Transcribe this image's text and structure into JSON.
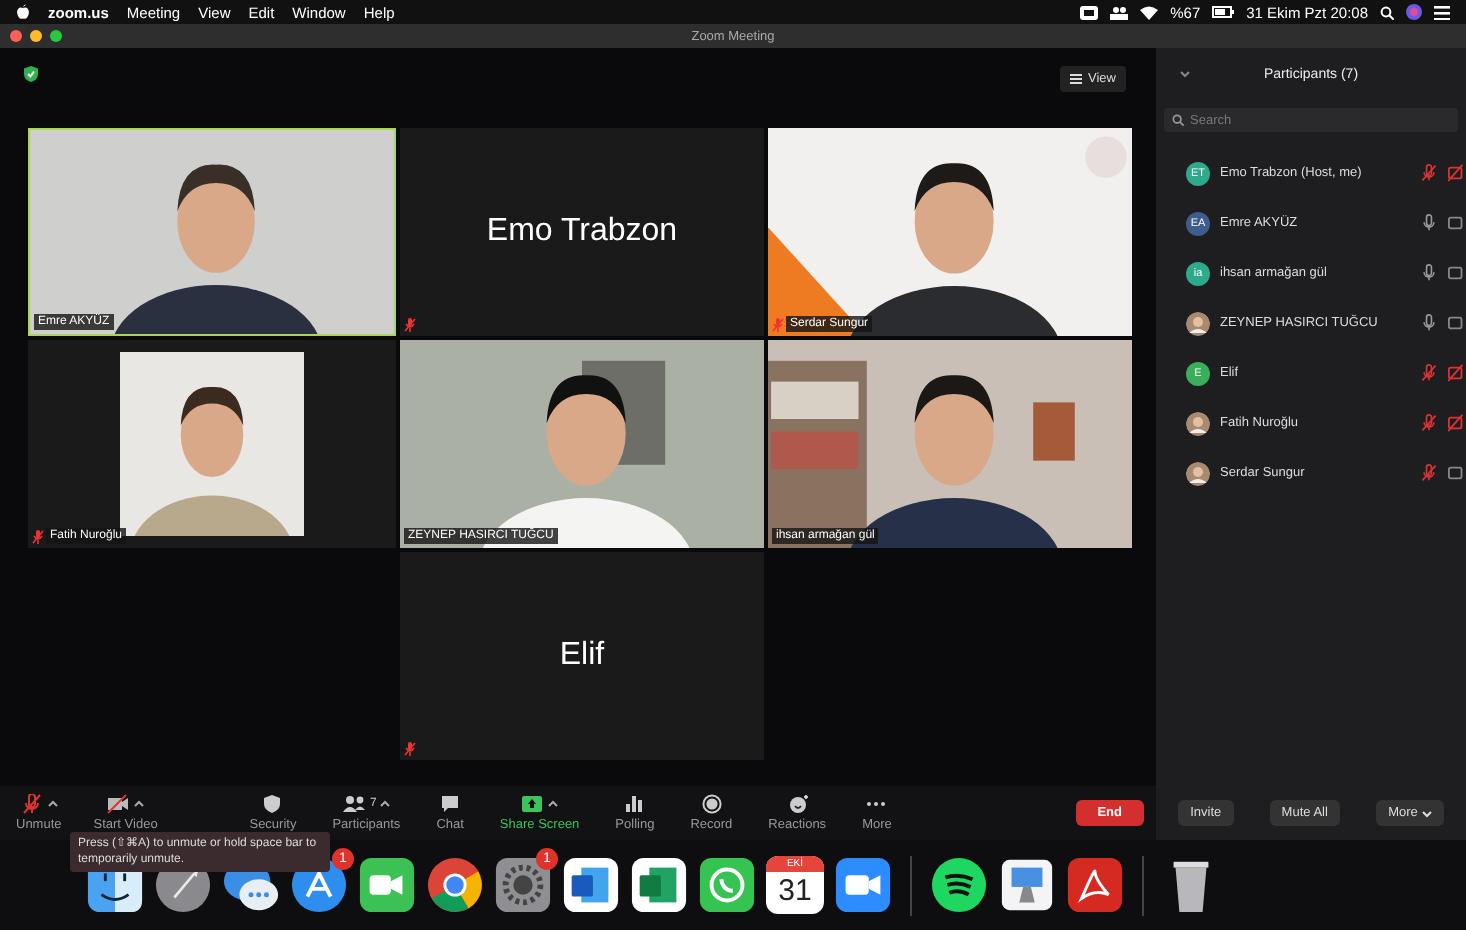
{
  "menu_bar": {
    "app": "zoom.us",
    "menus": [
      "Meeting",
      "View",
      "Edit",
      "Window",
      "Help"
    ],
    "battery": "%67",
    "clock": "31 Ekim Pzt 20:08"
  },
  "window": {
    "title": "Zoom Meeting"
  },
  "view_button": "View",
  "tiles": [
    {
      "kind": "video",
      "name": "Emre AKYÜZ",
      "active": true,
      "muted": false
    },
    {
      "kind": "name",
      "name": "Emo Trabzon",
      "active": false,
      "muted": true
    },
    {
      "kind": "video",
      "name": "Serdar Sungur",
      "active": false,
      "muted": true
    },
    {
      "kind": "portrait",
      "name": "Fatih Nuroğlu",
      "active": false,
      "muted": true
    },
    {
      "kind": "video",
      "name": "ZEYNEP HASIRCI TUĞCU",
      "active": false,
      "muted": false
    },
    {
      "kind": "video",
      "name": "ihsan armağan gül",
      "active": false,
      "muted": false
    },
    {
      "kind": "name",
      "name": "Elif",
      "active": false,
      "muted": true
    }
  ],
  "participants_panel": {
    "title": "Participants (7)",
    "search": {
      "placeholder": "Search"
    },
    "participants": [
      {
        "name": "Emo Trabzon (Host, me)",
        "kind": "initials",
        "initials": "ET",
        "color": "#2fa98c",
        "muted": true,
        "video_off": true
      },
      {
        "name": "Emre AKYÜZ",
        "kind": "initials",
        "initials": "EA",
        "color": "#3d5d8c",
        "muted": false,
        "video_off": false
      },
      {
        "name": "ihsan armağan gül",
        "kind": "initials",
        "initials": "ia",
        "color": "#2fa98c",
        "muted": false,
        "video_off": false
      },
      {
        "name": "ZEYNEP HASIRCI TUĞCU",
        "kind": "picture",
        "muted": false,
        "video_off": false
      },
      {
        "name": "Elif",
        "kind": "initials",
        "initials": "E",
        "color": "#3aae5a",
        "muted": true,
        "video_off": true
      },
      {
        "name": "Fatih Nuroğlu",
        "kind": "picture",
        "muted": true,
        "video_off": true
      },
      {
        "name": "Serdar Sungur",
        "kind": "picture",
        "muted": true,
        "video_off": false
      }
    ],
    "buttons": [
      "Invite",
      "Mute All",
      "More"
    ]
  },
  "toolbar": {
    "items": [
      {
        "kind": "unmute",
        "label": "Unmute",
        "caret": true
      },
      {
        "kind": "video",
        "label": "Start Video",
        "caret": true
      },
      {
        "kind": "security",
        "label": "Security",
        "caret": false
      },
      {
        "kind": "participants",
        "label": "Participants",
        "count": "7",
        "caret": true
      },
      {
        "kind": "chat",
        "label": "Chat",
        "caret": false
      },
      {
        "kind": "share",
        "label": "Share Screen",
        "caret": true
      },
      {
        "kind": "polling",
        "label": "Polling",
        "caret": false
      },
      {
        "kind": "record",
        "label": "Record",
        "caret": false
      },
      {
        "kind": "reactions",
        "label": "Reactions",
        "caret": false
      },
      {
        "kind": "more",
        "label": "More",
        "caret": false
      }
    ],
    "end": "End"
  },
  "tooltip": "Press (⇧⌘A) to unmute or hold space bar to temporarily unmute.",
  "dock": [
    {
      "kind": "finder"
    },
    {
      "kind": "launchpad"
    },
    {
      "kind": "messages"
    },
    {
      "kind": "appstore",
      "badge": "1"
    },
    {
      "kind": "facetime"
    },
    {
      "kind": "chrome"
    },
    {
      "kind": "settings",
      "badge": "1"
    },
    {
      "kind": "word"
    },
    {
      "kind": "excel"
    },
    {
      "kind": "whatsapp"
    },
    {
      "kind": "calendar",
      "month": "EKİ",
      "day": "31"
    },
    {
      "kind": "zoom"
    },
    {
      "kind": "separator"
    },
    {
      "kind": "spotify"
    },
    {
      "kind": "keynote"
    },
    {
      "kind": "acrobat"
    },
    {
      "kind": "separator"
    },
    {
      "kind": "trash"
    }
  ]
}
